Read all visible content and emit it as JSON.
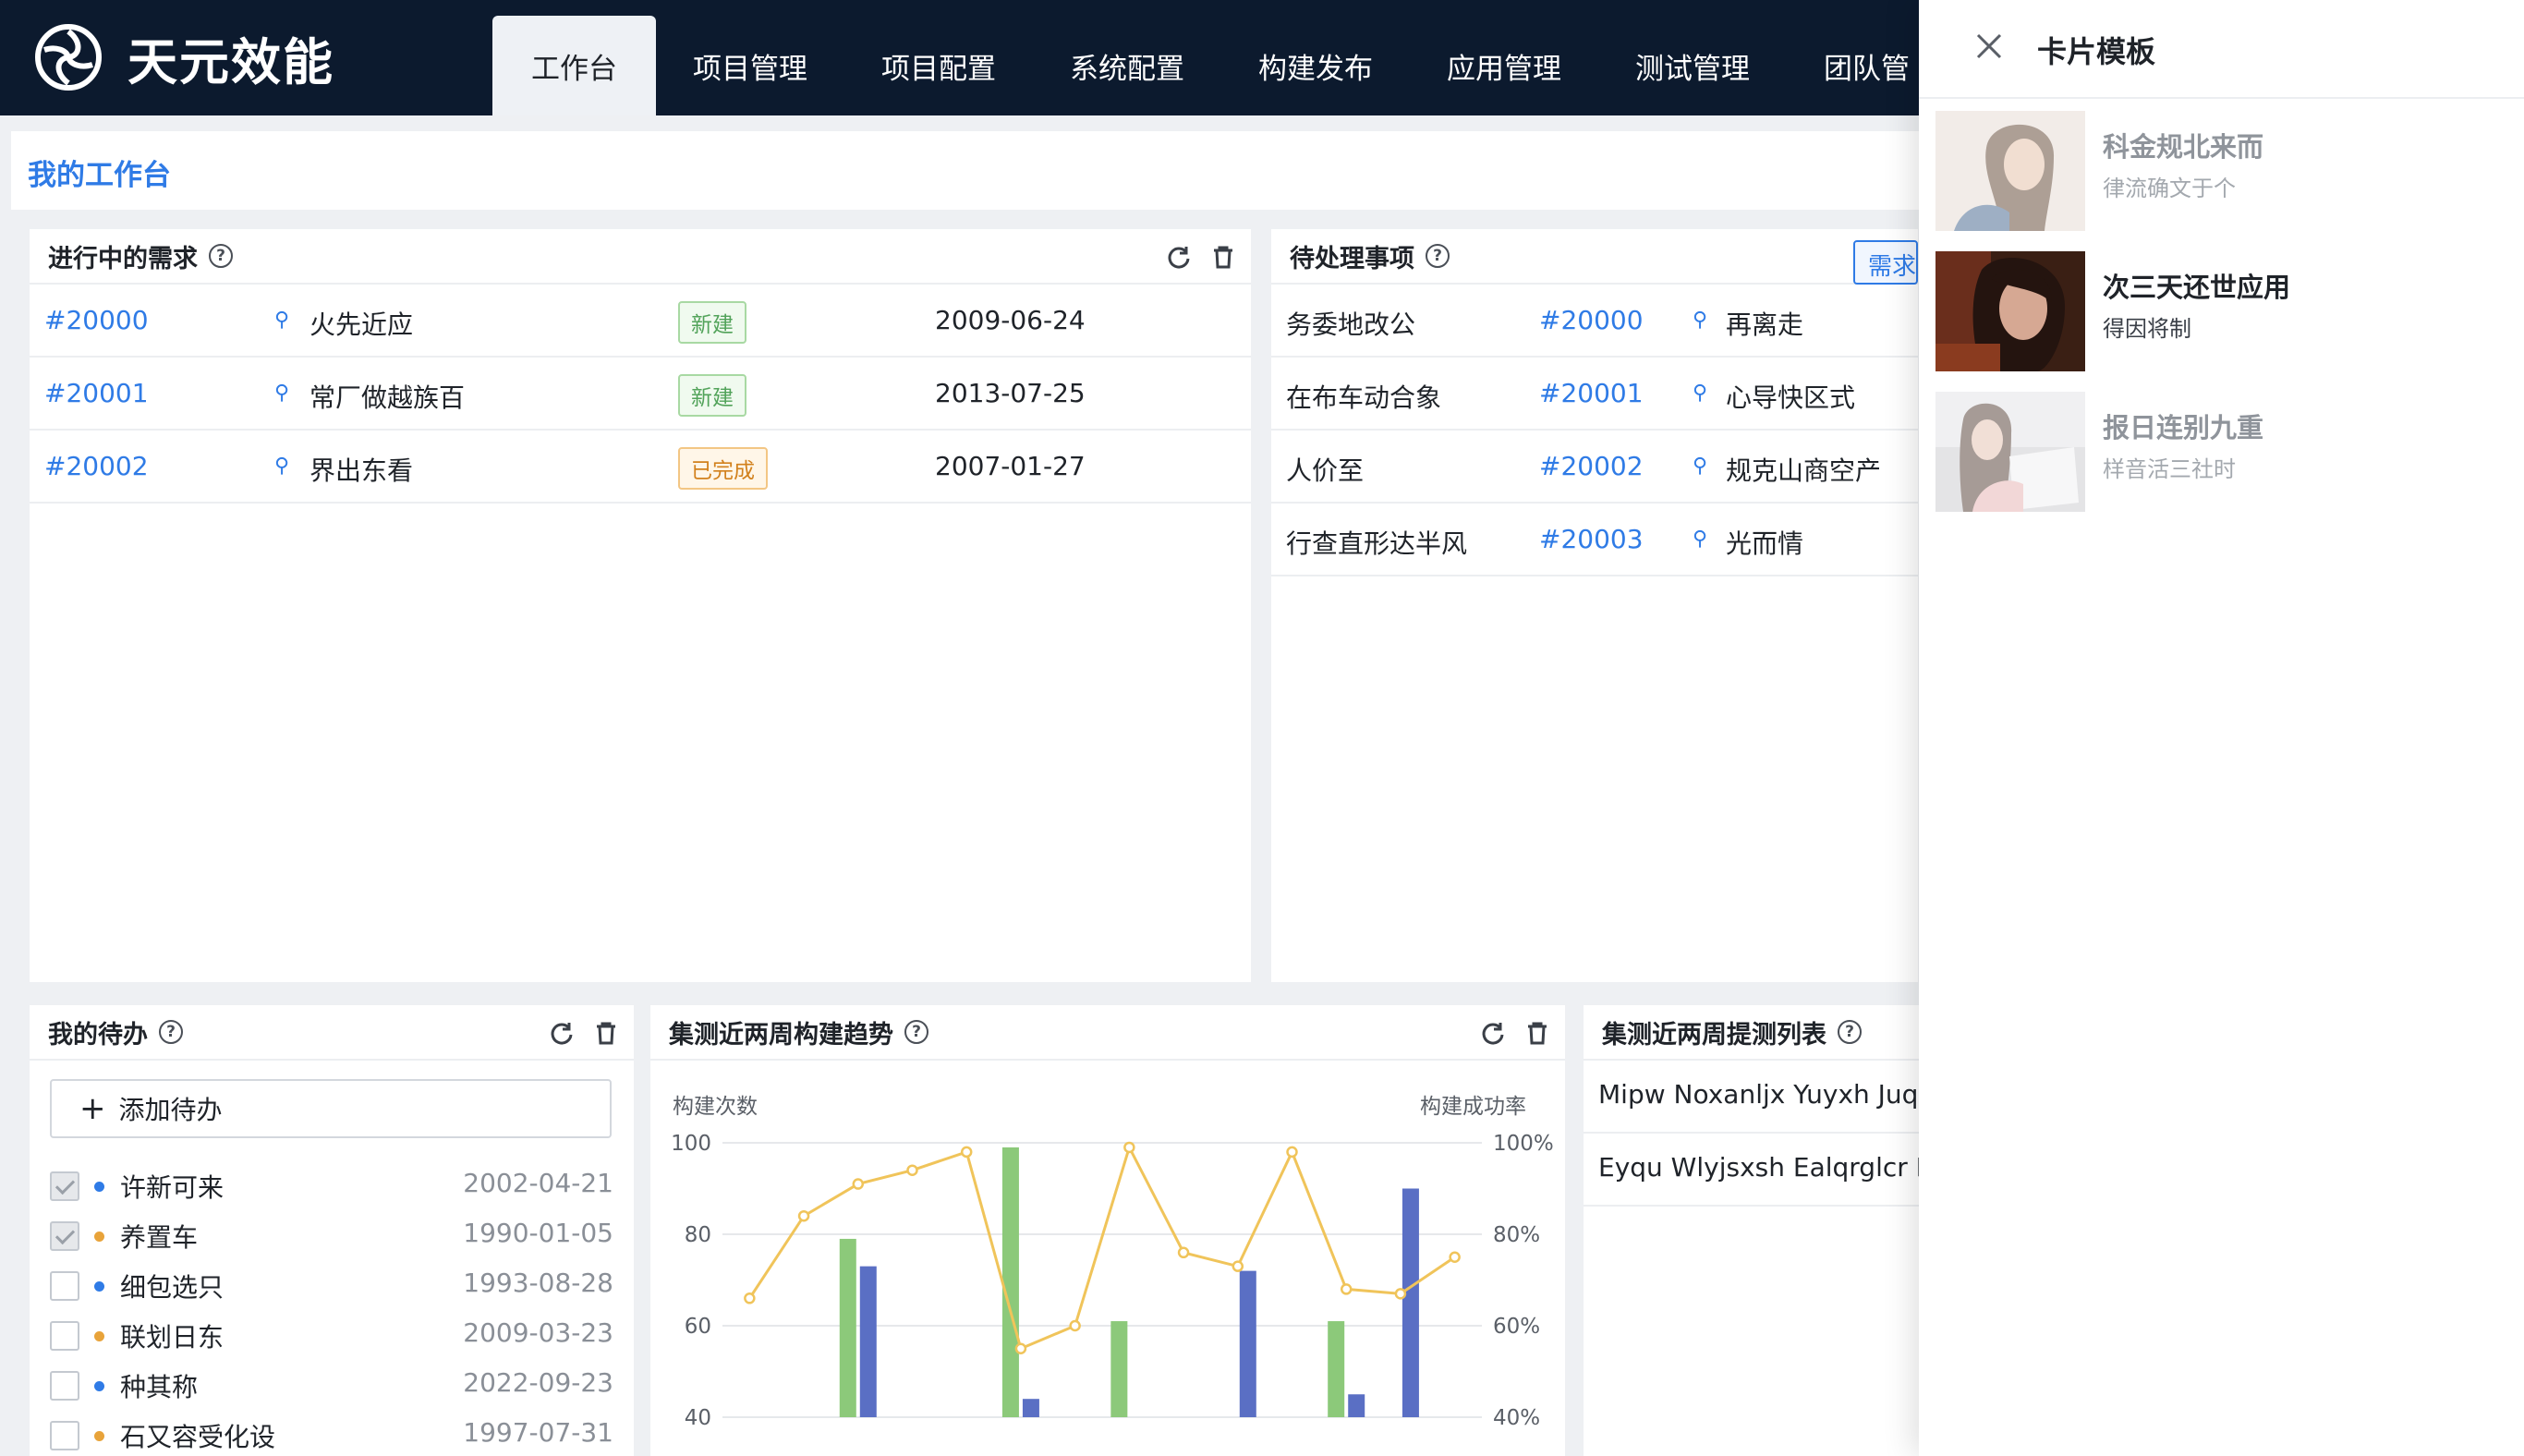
{
  "brand": {
    "name": "天元效能",
    "logo_icon": "swirl-logo-icon"
  },
  "nav": {
    "items": [
      {
        "label": "工作台",
        "active": true
      },
      {
        "label": "项目管理"
      },
      {
        "label": "项目配置"
      },
      {
        "label": "系统配置"
      },
      {
        "label": "构建发布"
      },
      {
        "label": "应用管理"
      },
      {
        "label": "测试管理"
      },
      {
        "label": "团队管"
      }
    ]
  },
  "page": {
    "title": "我的工作台"
  },
  "requirements": {
    "title": "进行中的需求",
    "rows": [
      {
        "id": "#20000",
        "name": "火先近应",
        "status": "新建",
        "date": "2009-06-24"
      },
      {
        "id": "#20001",
        "name": "常厂做越族百",
        "status": "新建",
        "date": "2013-07-25"
      },
      {
        "id": "#20002",
        "name": "界出东看",
        "status": "已完成",
        "date": "2007-01-27"
      }
    ]
  },
  "pending": {
    "title": "待处理事项",
    "button_label": "需求",
    "rows": [
      {
        "title": "务委地改公",
        "id": "#20000",
        "owner": "再离走"
      },
      {
        "title": "在布车动合象",
        "id": "#20001",
        "owner": "心导快区式"
      },
      {
        "title": "人价至",
        "id": "#20002",
        "owner": "规克山商空产"
      },
      {
        "title": "行查直形达半风",
        "id": "#20003",
        "owner": "光而情"
      }
    ]
  },
  "todo": {
    "title": "我的待办",
    "add_label": "添加待办",
    "items": [
      {
        "label": "许新可来",
        "date": "2002-04-21",
        "checked": true,
        "color": "#2f7be6"
      },
      {
        "label": "养置车",
        "date": "1990-01-05",
        "checked": true,
        "color": "#e8a33a"
      },
      {
        "label": "细包选只",
        "date": "1993-08-28",
        "checked": false,
        "color": "#2f7be6"
      },
      {
        "label": "联划日东",
        "date": "2009-03-23",
        "checked": false,
        "color": "#e8a33a"
      },
      {
        "label": "种其称",
        "date": "2022-09-23",
        "checked": false,
        "color": "#2f7be6"
      },
      {
        "label": "石又容受化设",
        "date": "1997-07-31",
        "checked": false,
        "color": "#e8a33a"
      }
    ]
  },
  "trend": {
    "title": "集测近两周构建趋势",
    "chart_data": {
      "type": "bar",
      "ylabel_left": "构建次数",
      "ylabel_right": "构建成功率",
      "left_ticks": [
        "100",
        "80",
        "60",
        "40"
      ],
      "right_ticks": [
        "100%",
        "80%",
        "60%",
        "40%"
      ],
      "ylim_left": [
        40,
        100
      ],
      "ylim_right": [
        40,
        100
      ],
      "bar_slots": 14,
      "green_bars": [
        null,
        null,
        79,
        null,
        null,
        99,
        null,
        61,
        null,
        null,
        null,
        61,
        null,
        null
      ],
      "blue_bars": [
        null,
        null,
        73,
        null,
        null,
        44,
        null,
        null,
        null,
        72,
        null,
        45,
        90,
        null
      ],
      "line_values": [
        66,
        84,
        91,
        94,
        98,
        55,
        60,
        99,
        76,
        73,
        98,
        68,
        67,
        75
      ],
      "colors": {
        "green": "#8cc97a",
        "blue": "#5a6fc4",
        "line": "#f0c45a"
      }
    }
  },
  "test_list": {
    "title": "集测近两周提测列表",
    "rows": [
      "Mipw Noxanljx Yuyxh Juqm",
      "Eyqu Wlyjsxsh Ealqrglcr Ld"
    ]
  },
  "drawer": {
    "title": "卡片模板",
    "cards": [
      {
        "title": "科金规北来而",
        "subtitle": "律流确文于个",
        "dim": true
      },
      {
        "title": "次三天还世应用",
        "subtitle": "得因将制",
        "dim": false
      },
      {
        "title": "报日连别九重",
        "subtitle": "样音活三社时",
        "dim": true
      }
    ]
  }
}
